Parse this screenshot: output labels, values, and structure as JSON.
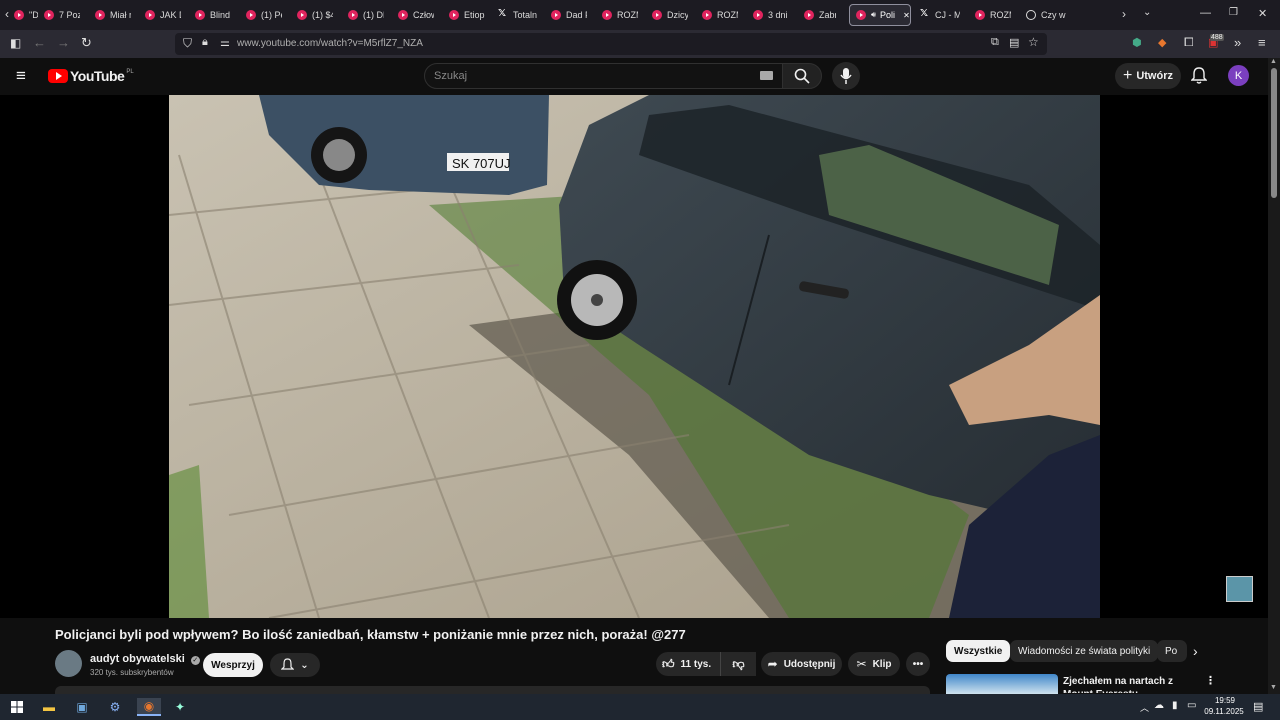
{
  "browser": {
    "tabs": [
      {
        "label": "\"D",
        "icon": "youtube-icon"
      },
      {
        "label": "7 Pozi",
        "icon": "youtube-icon"
      },
      {
        "label": "Miał r",
        "icon": "youtube-icon"
      },
      {
        "label": "JAK D",
        "icon": "youtube-icon"
      },
      {
        "label": "Blind",
        "icon": "youtube-icon"
      },
      {
        "label": "(1) Pe",
        "icon": "youtube-icon"
      },
      {
        "label": "(1) $4",
        "icon": "youtube-icon"
      },
      {
        "label": "(1) DL",
        "icon": "youtube-icon"
      },
      {
        "label": "Człow",
        "icon": "youtube-icon"
      },
      {
        "label": "Etiopi",
        "icon": "youtube-icon"
      },
      {
        "label": "Totaln",
        "icon": "x-icon"
      },
      {
        "label": "Dad F",
        "icon": "youtube-icon"
      },
      {
        "label": "ROZM",
        "icon": "youtube-icon"
      },
      {
        "label": "Dzicy",
        "icon": "youtube-icon"
      },
      {
        "label": "ROZM",
        "icon": "youtube-icon"
      },
      {
        "label": "3 dni",
        "icon": "youtube-icon"
      },
      {
        "label": "Zabra",
        "icon": "youtube-icon"
      },
      {
        "label": "Poli",
        "icon": "youtube-icon",
        "active": true
      },
      {
        "label": "CJ - M",
        "icon": "x-icon"
      },
      {
        "label": "ROZM",
        "icon": "youtube-icon"
      },
      {
        "label": "Czy w",
        "icon": "globe-icon"
      }
    ],
    "url": "www.youtube.com/watch?v=M5rflZ7_NZA",
    "extension_badge": "488"
  },
  "youtube": {
    "logo_text": "YouTube",
    "region": "PL",
    "search_placeholder": "Szukaj",
    "create_label": "Utwórz",
    "avatar_letter": "K",
    "video": {
      "plate": "SK 707UJ",
      "title": "Policjanci byli pod wpływem? Bo ilość zaniedbań, kłamstw + poniżanie mnie przez nich, poraża! @277",
      "channel": "audyt obywatelski",
      "subscribers": "320 tys. subskrybentów",
      "support_label": "Wesprzyj",
      "likes": "11 tys.",
      "share_label": "Udostępnij",
      "clip_label": "Klip"
    },
    "chips": [
      "Wszystkie",
      "Wiadomości ze świata polityki",
      "Po"
    ],
    "recommendation_title": "Zjechałem na nartach z Mount Everestu"
  },
  "taskbar": {
    "time": "19:59",
    "date": "09.11.2025"
  }
}
